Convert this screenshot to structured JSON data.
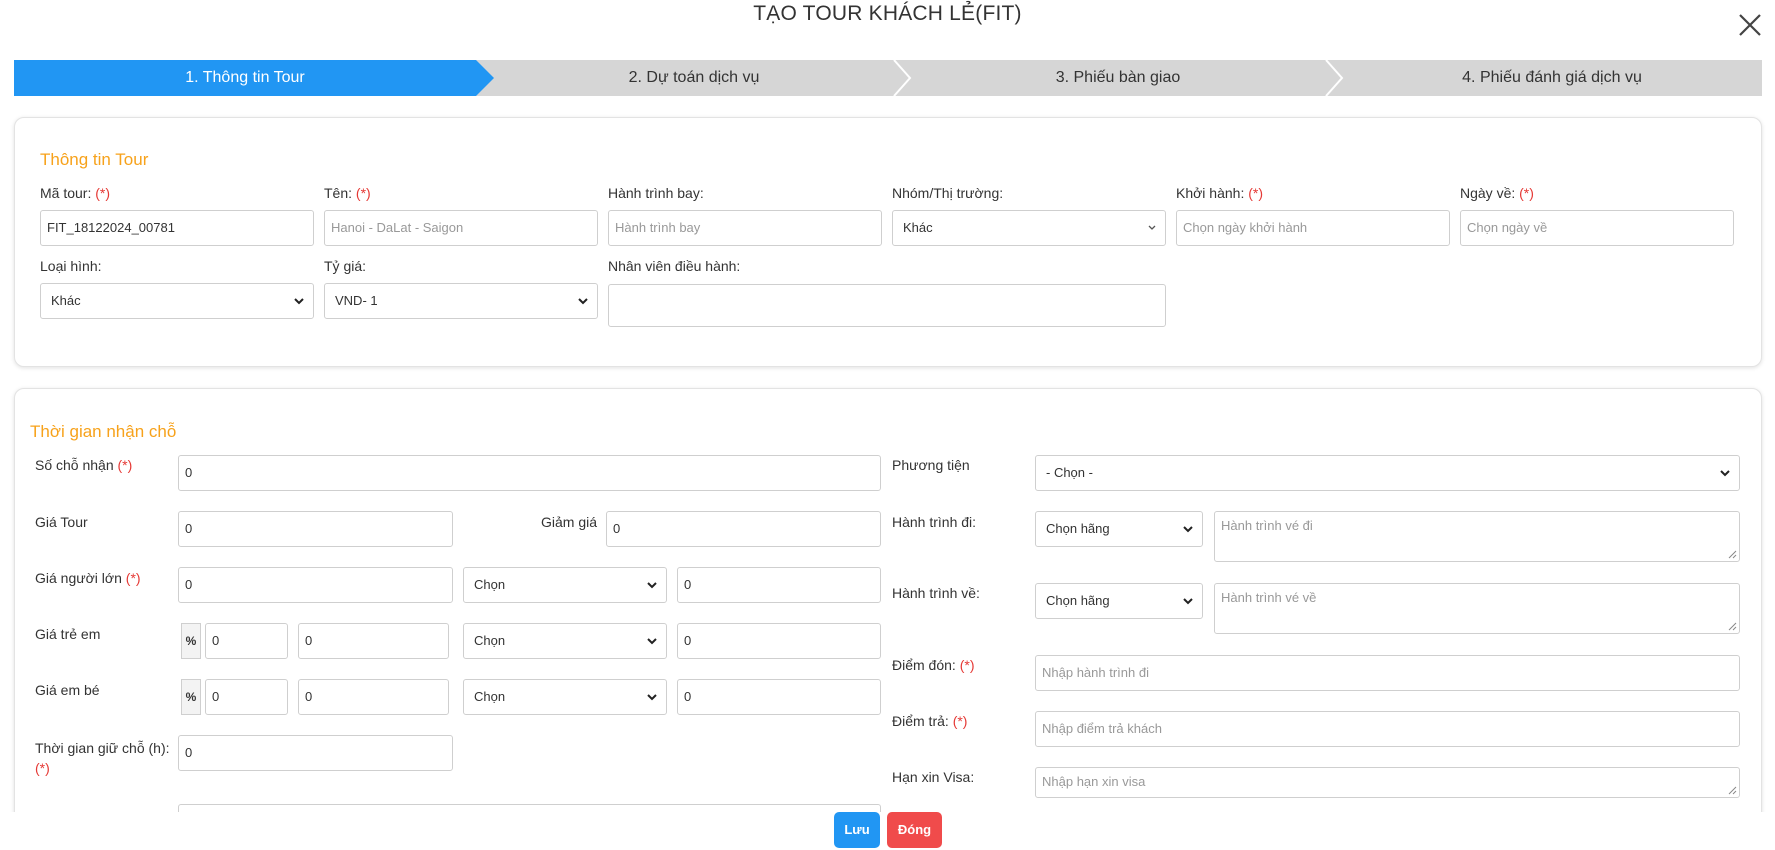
{
  "title": "TẠO TOUR KHÁCH LẺ(FIT)",
  "colors": {
    "accent": "#2196f3",
    "section": "#f7a21b",
    "required": "#e53935",
    "danger": "#f04b4b",
    "step_inactive": "#d6d6d6"
  },
  "steps": [
    {
      "label": "1. Thông tin Tour"
    },
    {
      "label": "2. Dự toán dịch vụ"
    },
    {
      "label": "3. Phiếu bàn giao"
    },
    {
      "label": "4. Phiếu đánh giá dịch vụ"
    }
  ],
  "tour_info": {
    "section_title": "Thông tin Tour",
    "required_mark": "(*)",
    "ma_tour": {
      "label": "Mã tour:",
      "value": "FIT_18122024_00781"
    },
    "ten": {
      "label": "Tên:",
      "placeholder": "Hanoi - DaLat - Saigon"
    },
    "hanh_trinh_bay": {
      "label": "Hành trình bay:",
      "placeholder": "Hành trình bay"
    },
    "nhom": {
      "label": "Nhóm/Thị trường:",
      "value": "Khác"
    },
    "khoi_hanh": {
      "label": "Khởi hành:",
      "placeholder": "Chọn ngày khởi hành"
    },
    "ngay_ve": {
      "label": "Ngày về:",
      "placeholder": "Chọn ngày về"
    },
    "loai_hinh": {
      "label": "Loại hình:",
      "value": "Khác"
    },
    "ty_gia": {
      "label": "Tỷ giá:",
      "value": "VND- 1"
    },
    "nhan_vien": {
      "label": "Nhân viên điều hành:"
    }
  },
  "booking": {
    "section_title": "Thời gian nhận chỗ",
    "so_cho": {
      "label": "Số chỗ nhận",
      "value": "0"
    },
    "gia_tour": {
      "label": "Giá Tour",
      "value": "0"
    },
    "giam_gia": {
      "label": "Giảm giá",
      "value": "0"
    },
    "gia_nguoi_lon": {
      "label": "Giá người lớn",
      "value": "0",
      "select": "Chọn",
      "value2": "0"
    },
    "gia_tre_em": {
      "label": "Giá trẻ em",
      "pct": "%",
      "value1": "0",
      "value2": "0",
      "select": "Chọn",
      "value3": "0"
    },
    "gia_em_be": {
      "label": "Giá em bé",
      "pct": "%",
      "value1": "0",
      "value2": "0",
      "select": "Chọn",
      "value3": "0"
    },
    "giu_cho": {
      "label": "Thời gian giữ chỗ (h):",
      "value": "0"
    },
    "phuong_tien": {
      "label": "Phương tiện",
      "value": "- Chọn -"
    },
    "hanh_trinh_di": {
      "label": "Hành trình đi:",
      "select": "Chọn hãng",
      "placeholder": "Hành trình vé đi"
    },
    "hanh_trinh_ve": {
      "label": "Hành trình về:",
      "select": "Chọn hãng",
      "placeholder": "Hành trình vé về"
    },
    "diem_don": {
      "label": "Điểm đón:",
      "placeholder": "Nhập hành trình đi"
    },
    "diem_tra": {
      "label": "Điểm trả:",
      "placeholder": "Nhập điểm trả khách"
    },
    "han_visa": {
      "label": "Hạn xin Visa:",
      "placeholder": "Nhập hạn xin visa"
    }
  },
  "footer": {
    "save": "Lưu",
    "close": "Đóng"
  }
}
